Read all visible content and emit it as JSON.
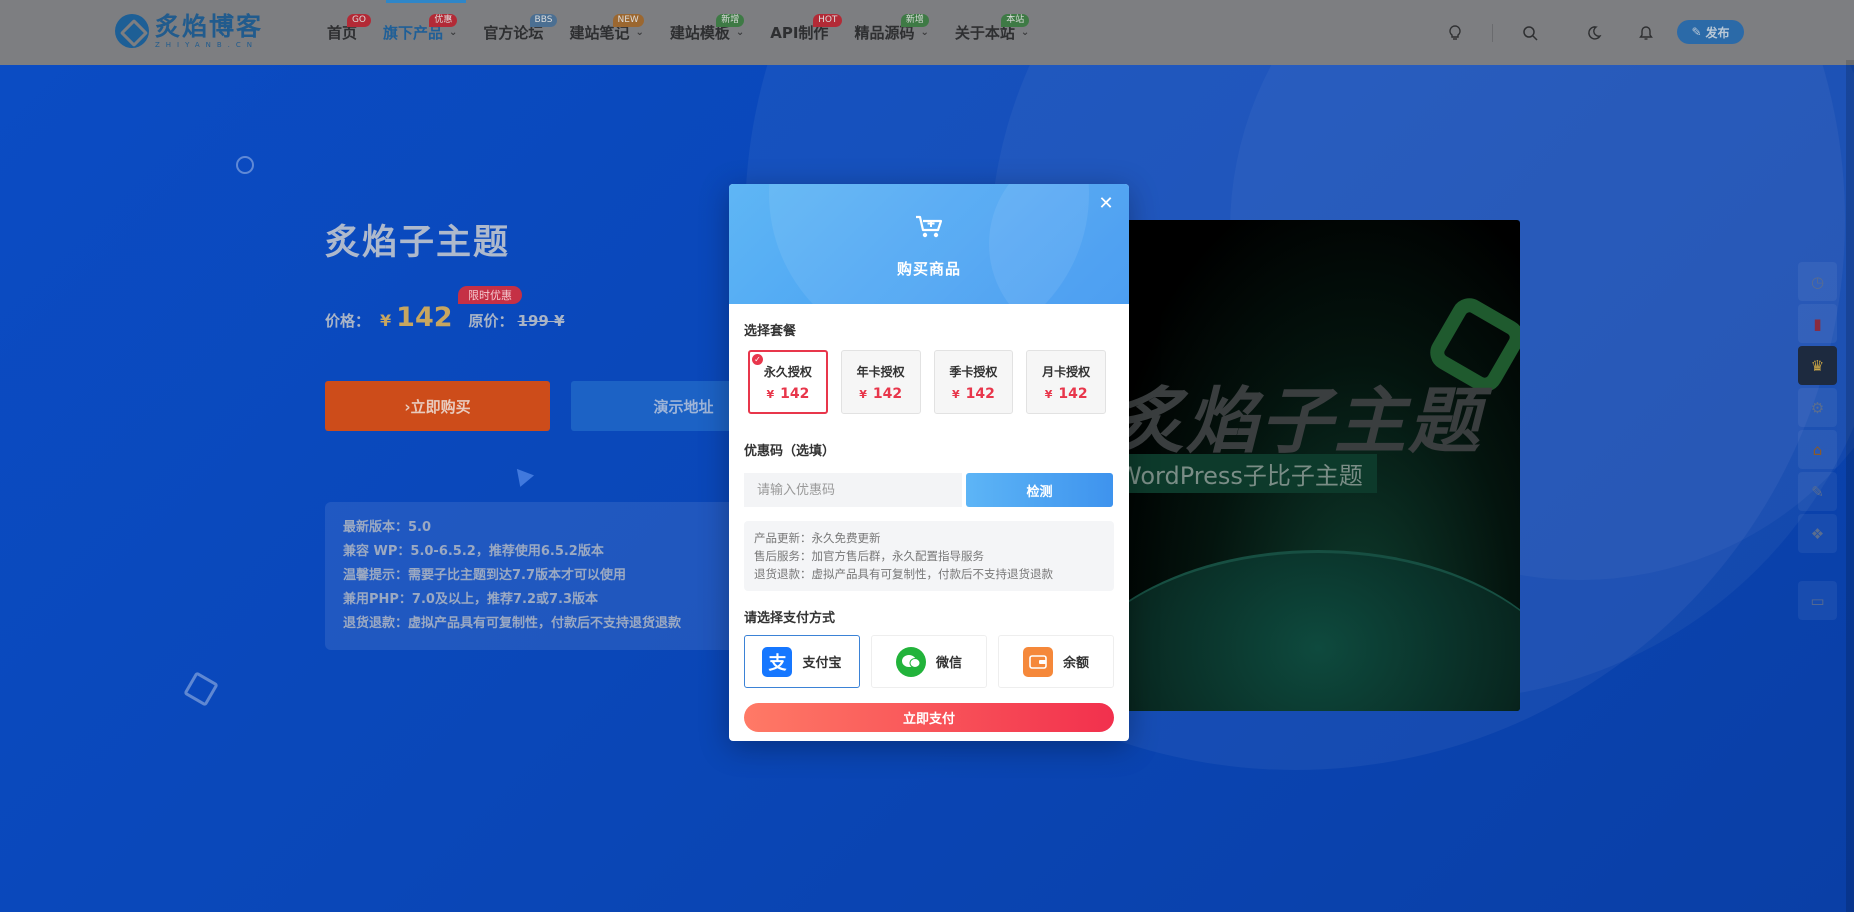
{
  "nav": {
    "logo_cn": "炙焰博客",
    "logo_en": "ZHIYANB.CN",
    "items": [
      {
        "label": "首页",
        "badge": "GO",
        "badge_color": "#b32a36",
        "chevron": false,
        "active": false
      },
      {
        "label": "旗下产品",
        "badge": "优惠",
        "badge_color": "#b32a36",
        "chevron": true,
        "active": true
      },
      {
        "label": "官方论坛",
        "badge": "BBS",
        "badge_color": "#4b6f92",
        "chevron": false,
        "active": false
      },
      {
        "label": "建站笔记",
        "badge": "NEW",
        "badge_color": "#9b6730",
        "chevron": true,
        "active": false
      },
      {
        "label": "建站模板",
        "badge": "新增",
        "badge_color": "#3e7a45",
        "chevron": true,
        "active": false
      },
      {
        "label": "API制作",
        "badge": "HOT",
        "badge_color": "#b32a36",
        "chevron": false,
        "active": false
      },
      {
        "label": "精品源码",
        "badge": "新增",
        "badge_color": "#3e7a45",
        "chevron": true,
        "active": false
      },
      {
        "label": "关于本站",
        "badge": "本站",
        "badge_color": "#3e7a45",
        "chevron": true,
        "active": false
      }
    ],
    "icons": [
      "lightbulb-icon",
      "search-icon",
      "moon-icon",
      "bell-icon"
    ],
    "publish_label": "发布"
  },
  "hero": {
    "title": "炙焰子主题",
    "limit_badge": "限时优惠",
    "price_label": "价格：",
    "currency": "¥",
    "price": "142",
    "orig_label": "原价：",
    "orig_price": "199 ¥",
    "buy_label": "›立即购买",
    "demo_label": "演示地址",
    "info_lines": [
      "最新版本：5.0",
      "兼容 WP：5.0-6.5.2，推荐使用6.5.2版本",
      "温馨提示：需要子比主题到达7.7版本才可以使用",
      "兼用PHP：7.0及以上，推荐7.2或7.3版本",
      "退货退款：虚拟产品具有可复制性，付款后不支持退货退款"
    ],
    "image_big_text": "炙焰子主题",
    "image_sub_text": "WordPress子比子主题"
  },
  "modal": {
    "title": "购买商品",
    "plan_section": "选择套餐",
    "plans": [
      {
        "name": "永久授权",
        "price": "142",
        "selected": true
      },
      {
        "name": "年卡授权",
        "price": "142",
        "selected": false
      },
      {
        "name": "季卡授权",
        "price": "142",
        "selected": false
      },
      {
        "name": "月卡授权",
        "price": "142",
        "selected": false
      }
    ],
    "currency": "¥",
    "coupon_section": "优惠码（选填）",
    "coupon_placeholder": "请输入优惠码",
    "coupon_value": "",
    "check_label": "检测",
    "notices": [
      "产品更新：永久免费更新",
      "售后服务：加官方售后群，永久配置指导服务",
      "退货退款：虚拟产品具有可复制性，付款后不支持退货退款"
    ],
    "pay_section": "请选择支付方式",
    "pay_methods": [
      {
        "name": "支付宝",
        "icon": "alipay-icon",
        "color": "#1677ff",
        "selected": true
      },
      {
        "name": "微信",
        "icon": "wechat-icon",
        "color": "#22b33b",
        "selected": false
      },
      {
        "name": "余额",
        "icon": "wallet-icon",
        "color": "#f5883a",
        "selected": false
      }
    ],
    "pay_button": "立即支付"
  },
  "rail": {
    "icons": [
      "clock-icon",
      "red-packet-icon",
      "crown-icon",
      "gear-icon",
      "home-icon",
      "edit-icon",
      "gift-icon",
      "chat-icon"
    ]
  }
}
